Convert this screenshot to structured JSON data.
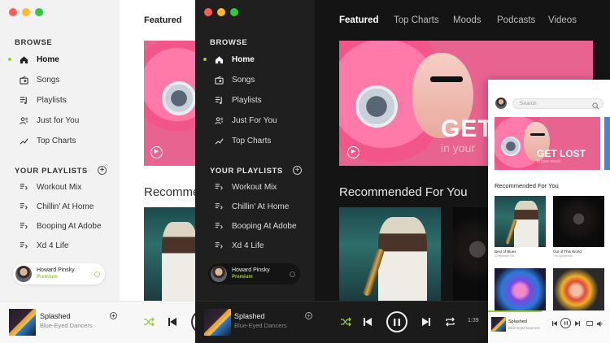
{
  "sidebar": {
    "browse_heading": "BROWSE",
    "items": [
      {
        "label": "Home",
        "icon": "home-icon",
        "active": true
      },
      {
        "label": "Songs",
        "icon": "radio-icon"
      },
      {
        "label": "Playlists",
        "icon": "playlist-icon"
      },
      {
        "label": "Just for You",
        "icon": "users-icon"
      },
      {
        "label": "Top Charts",
        "icon": "trend-icon"
      }
    ],
    "dark_items": [
      "Home",
      "Songs",
      "Playlists",
      "Just For You",
      "Top Charts"
    ],
    "playlists_heading": "YOUR PLAYLISTS",
    "playlists": [
      "Workout Mix",
      "Chillin' At Home",
      "Booping At Adobe",
      "Xd 4 Life"
    ]
  },
  "profile": {
    "name": "Howard Pinsky",
    "tier": "Premium"
  },
  "topnav": [
    "Featured",
    "Top Charts",
    "Moods",
    "Podcasts",
    "Videos"
  ],
  "light_main": {
    "featured": "Featured",
    "recommended": "Recommen"
  },
  "hero": {
    "title": "GET",
    "subtitle": "in your"
  },
  "recommended_heading": "Recommended For You",
  "player": {
    "track": "Splashed",
    "artist": "Blue-Eyed Dancers",
    "time": "1:39"
  },
  "mini": {
    "search_placeholder": "Search",
    "hero_title": "GET LOST",
    "hero_subtitle": "in your music",
    "recommended_heading": "Recommended For You",
    "cards": [
      {
        "title": "Best of Blues",
        "artist": "Compilation Vol."
      },
      {
        "title": "Out of This World",
        "artist": "The Spaceman"
      }
    ]
  },
  "colors": {
    "accent": "#9acd32",
    "hero_pink": "#e8638f",
    "dark_bg": "#141414"
  }
}
